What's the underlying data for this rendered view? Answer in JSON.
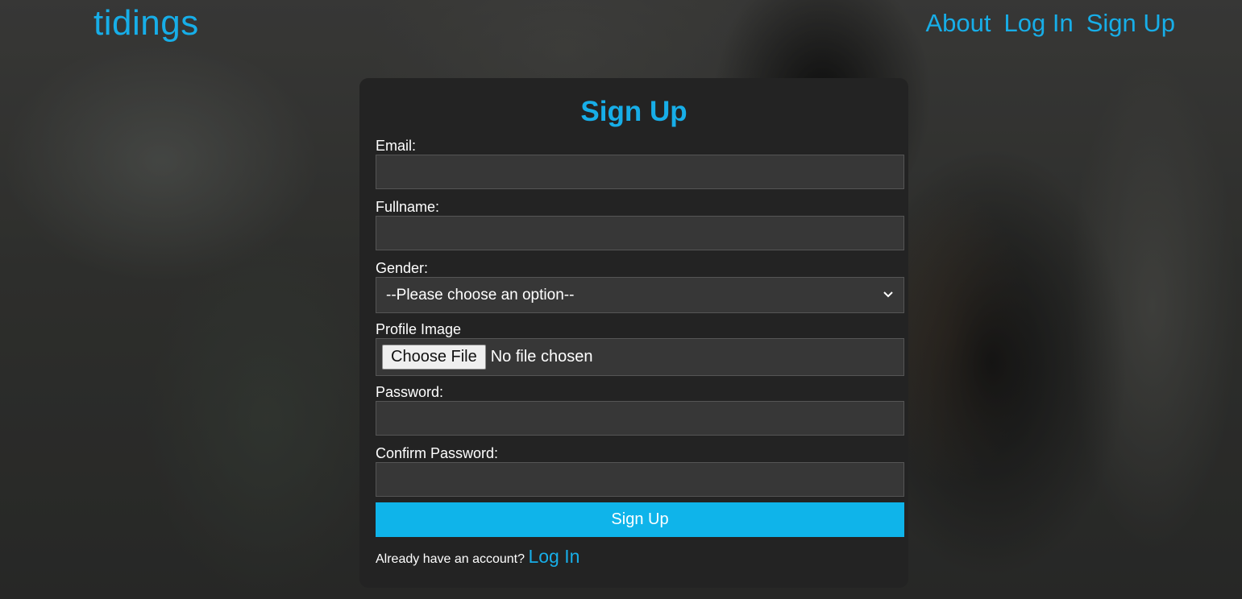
{
  "header": {
    "brand": "tidings",
    "nav": [
      "About",
      "Log In",
      "Sign Up"
    ]
  },
  "form": {
    "title": "Sign Up",
    "email_label": "Email:",
    "fullname_label": "Fullname:",
    "gender_label": "Gender:",
    "gender_selected": "--Please choose an option--",
    "profile_image_label": "Profile Image",
    "file_button": "Choose File",
    "file_status": "No file chosen",
    "password_label": "Password:",
    "confirm_password_label": "Confirm Password:",
    "submit_label": "Sign Up",
    "footer_text": "Already have an account?",
    "footer_link": "Log In"
  },
  "colors": {
    "accent": "#17aee8",
    "button": "#0fb4ea",
    "card": "#232323",
    "input": "#373737"
  },
  "icons": {
    "select_arrow": "chevron-down-icon"
  }
}
